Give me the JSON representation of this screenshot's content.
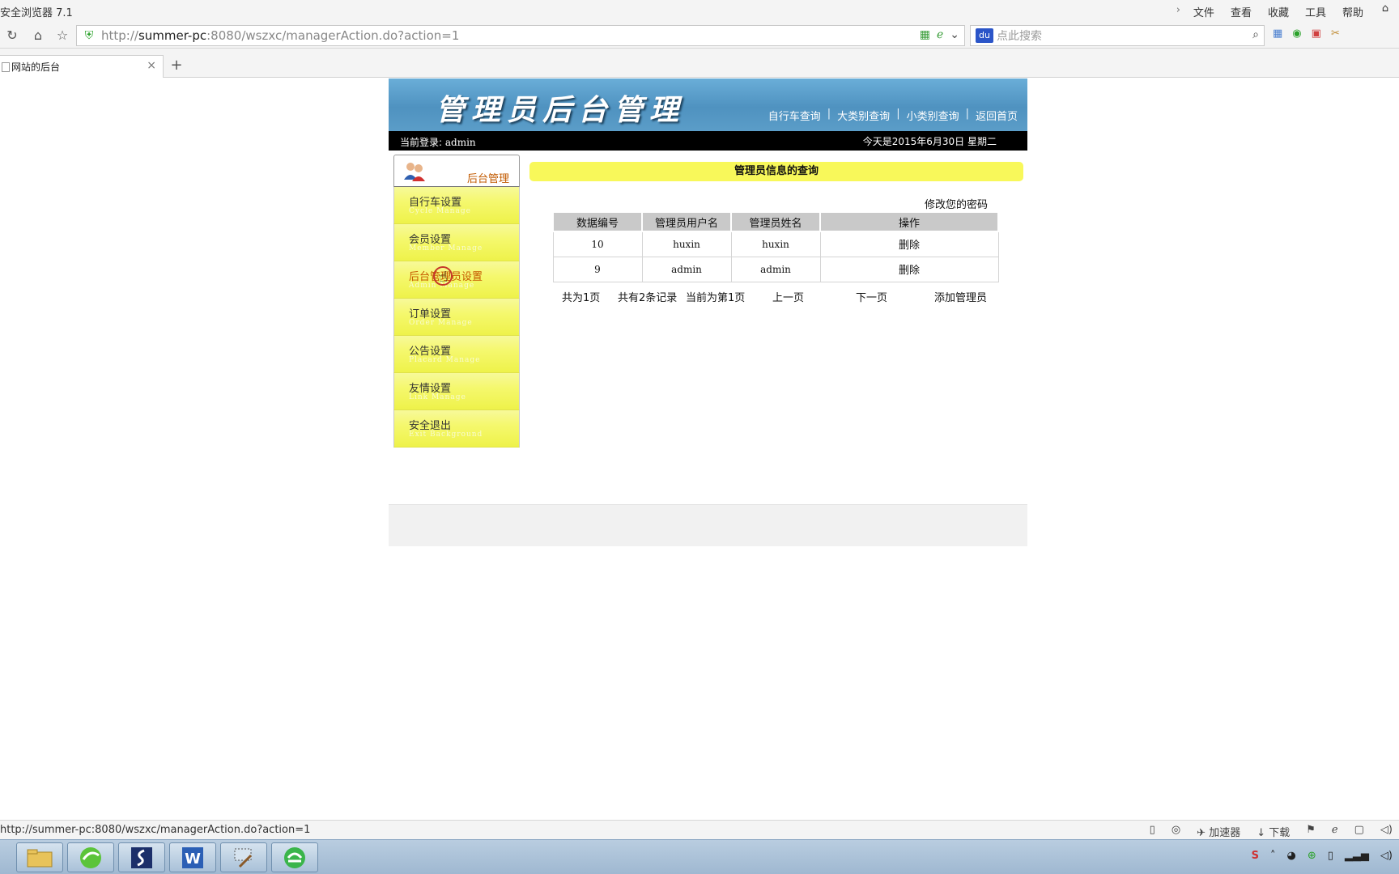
{
  "browser": {
    "app_title": "安全浏览器 7.1",
    "menu": [
      "文件",
      "查看",
      "收藏",
      "工具",
      "帮助"
    ],
    "url_prefix": "http://",
    "url_host": "summer-pc",
    "url_rest": ":8080/wszxc/managerAction.do?action=1",
    "search_placeholder": "点此搜索",
    "tab_title": "网站的后台",
    "status_url": "http://summer-pc:8080/wszxc/managerAction.do?action=1",
    "status_tools": [
      "加速器",
      "下载"
    ]
  },
  "header": {
    "title": "管理员后台管理",
    "links": [
      "自行车查询",
      "大类别查询",
      "小类别查询",
      "返回首页"
    ],
    "login_label": "当前登录:",
    "login_user": "admin",
    "date_text": "今天是2015年6月30日  星期二"
  },
  "sidebar": {
    "heading": "后台管理",
    "items": [
      {
        "label": "自行车设置",
        "sub": "Cycle Manage"
      },
      {
        "label": "会员设置",
        "sub": "Member Manage"
      },
      {
        "label": "后台管理员设置",
        "sub": "Admin Manage"
      },
      {
        "label": "订单设置",
        "sub": "Order Manage"
      },
      {
        "label": "公告设置",
        "sub": "Placard Manage"
      },
      {
        "label": "友情设置",
        "sub": "Link Manage"
      },
      {
        "label": "安全退出",
        "sub": "Exit Background"
      }
    ]
  },
  "main": {
    "title": "管理员信息的查询",
    "change_password": "修改您的密码",
    "columns": [
      "数据编号",
      "管理员用户名",
      "管理员姓名",
      "操作"
    ],
    "rows": [
      {
        "id": "10",
        "username": "huxin",
        "name": "huxin",
        "op": "删除"
      },
      {
        "id": "9",
        "username": "admin",
        "name": "admin",
        "op": "删除"
      }
    ],
    "pager": {
      "total_pages": "共为1页",
      "total_records": "共有2条记录",
      "current_page": "当前为第1页",
      "prev": "上一页",
      "next": "下一页",
      "add": "添加管理员"
    }
  },
  "colors": {
    "banner": "#5b9dc8",
    "sidebar_item": "#f5f86e",
    "title_bar": "#f8f85a",
    "active_item_text": "#c65a00"
  }
}
